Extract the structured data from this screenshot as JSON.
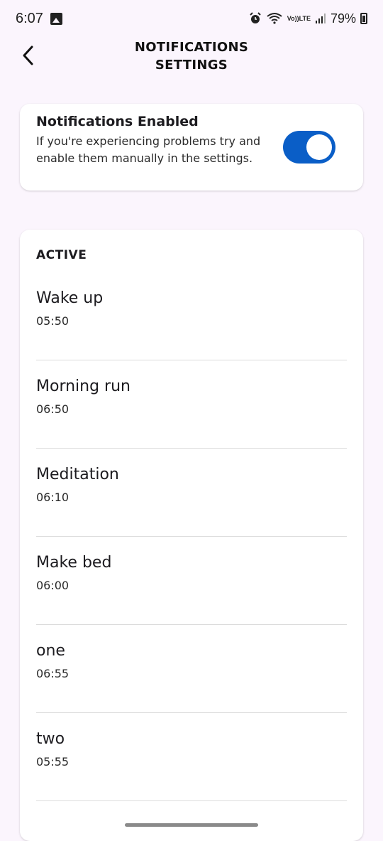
{
  "status_bar": {
    "time": "6:07",
    "gallery_icon": "gallery-icon",
    "alarm_icon": "alarm-icon",
    "wifi_icon": "wifi-icon",
    "volte_line1": "Vo))",
    "volte_line2": "LTE",
    "signal_icon": "signal-icon",
    "battery_percent": "79%",
    "battery_icon": "battery-icon"
  },
  "header": {
    "back_icon": "chevron-left-icon",
    "title": "NOTIFICATIONS SETTINGS"
  },
  "notifications": {
    "title": "Notifications Enabled",
    "description": "If you're experiencing problems try and enable them manually in the settings.",
    "enabled": true
  },
  "active": {
    "label": "ACTIVE",
    "items": [
      {
        "name": "Wake up",
        "time": "05:50"
      },
      {
        "name": "Morning run",
        "time": "06:50"
      },
      {
        "name": "Meditation",
        "time": "06:10"
      },
      {
        "name": "Make bed",
        "time": "06:00"
      },
      {
        "name": "one",
        "time": "06:55"
      },
      {
        "name": "two",
        "time": "05:55"
      }
    ]
  },
  "colors": {
    "background": "#fbf5fd",
    "toggle_on": "#0a5ec7",
    "card": "#ffffff"
  }
}
